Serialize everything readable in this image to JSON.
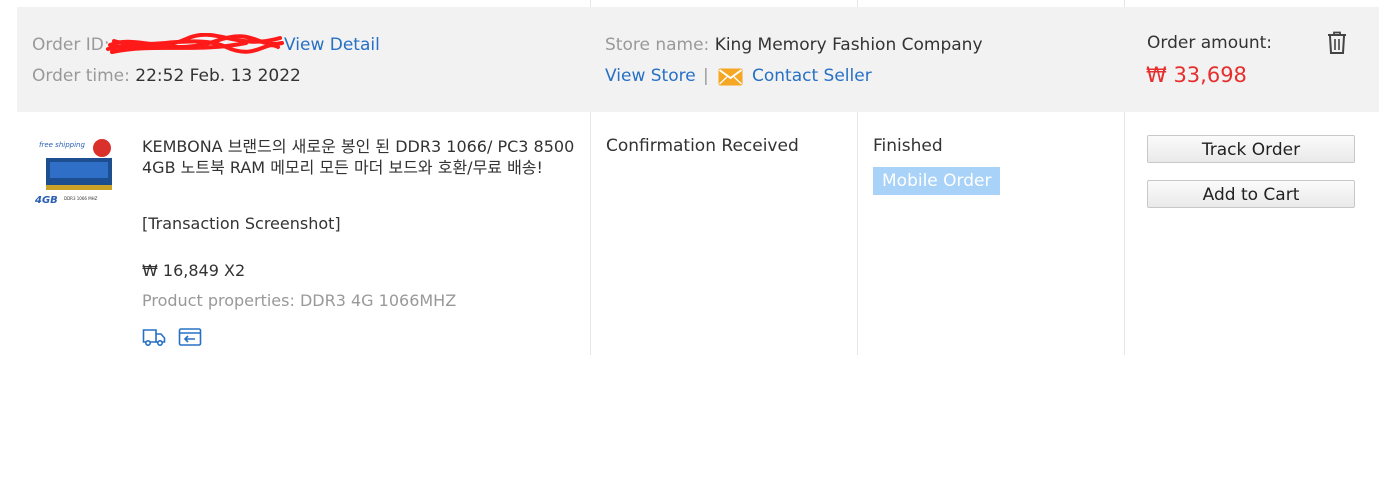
{
  "header": {
    "order_id_label": "Order ID:",
    "view_detail": "View Detail",
    "order_time_label": "Order time:",
    "order_time_value": "22:52 Feb. 13 2022",
    "store_name_label": "Store name:",
    "store_name_value": "King Memory Fashion Company",
    "view_store": "View Store",
    "separator": "|",
    "contact_seller": "Contact Seller",
    "order_amount_label": "Order amount:",
    "order_amount_value": "₩ 33,698"
  },
  "product": {
    "title": "KEMBONA 브랜드의 새로운 봉인 된 DDR3 1066/ PC3 8500 4GB 노트북 RAM 메모리 모든 마더 보드와 호환/무료 배송!",
    "snapshot_link": "[Transaction Screenshot]",
    "price_qty": "₩ 16,849 X2",
    "properties": "Product properties: DDR3 4G 1066MHZ",
    "thumb_text_1": "free shipping",
    "thumb_text_2": "4GB",
    "thumb_text_3": "DDR3 1066 MHZ"
  },
  "columns": {
    "shipping_status": "Confirmation Received",
    "order_status": "Finished",
    "order_badge": "Mobile Order"
  },
  "actions": {
    "track_order": "Track Order",
    "add_to_cart": "Add to Cart"
  },
  "icons": [
    "trash-icon",
    "envelope-icon",
    "truck-icon",
    "return-icon"
  ],
  "colors": {
    "link": "#2670c5",
    "price": "#e62e2e",
    "badge": "#a8d2f7",
    "envelope": "#f5a623",
    "header_bg": "#f2f2f2"
  }
}
